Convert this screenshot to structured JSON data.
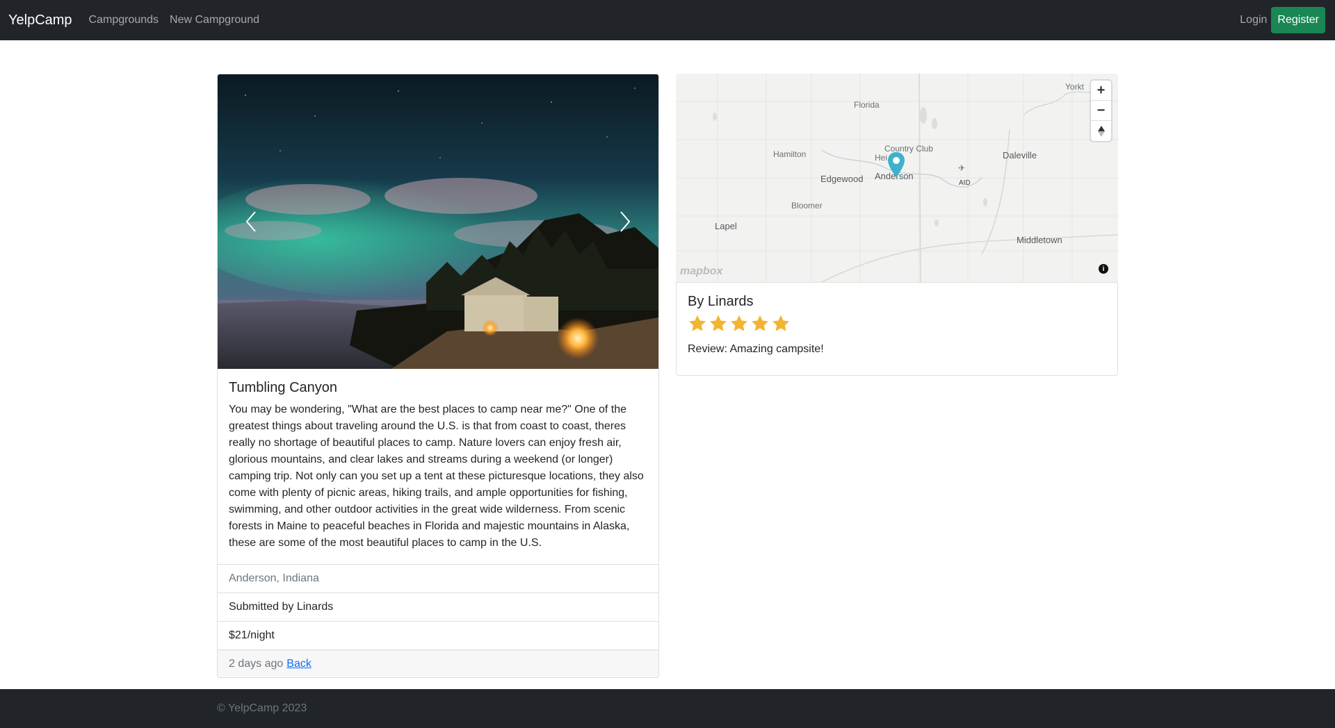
{
  "nav": {
    "brand": "YelpCamp",
    "links": [
      "Campgrounds",
      "New Campground"
    ],
    "login": "Login",
    "register": "Register"
  },
  "campground": {
    "title": "Tumbling Canyon",
    "description": "You may be wondering, \"What are the best places to camp near me?\" One of the greatest things about traveling around the U.S. is that from coast to coast, theres really no shortage of beautiful places to camp. Nature lovers can enjoy fresh air, glorious mountains, and clear lakes and streams during a weekend (or longer) camping trip. Not only can you set up a tent at these picturesque locations, they also come with plenty of picnic areas, hiking trails, and ample opportunities for fishing, swimming, and other outdoor activities in the great wide wilderness. From scenic forests in Maine to peaceful beaches in Florida and majestic mountains in Alaska, these are some of the most beautiful places to camp in the U.S.",
    "location": "Anderson, Indiana",
    "submitted_by": "Submitted by Linards",
    "price": "$21/night",
    "posted": "2 days ago",
    "back_link": "Back"
  },
  "map": {
    "labels": {
      "florida": "Florida",
      "yorktown": "Yorkt",
      "country_club": "Country Club",
      "hei": "Hei",
      "hamilton": "Hamilton",
      "daleville": "Daleville",
      "edgewood": "Edgewood",
      "anderson": "Anderson",
      "aid": "AID",
      "bloomer": "Bloomer",
      "lapel": "Lapel",
      "middletown": "Middletown"
    },
    "zoom_in": "+",
    "zoom_out": "−",
    "attribution_logo": "mapbox",
    "info": "i",
    "marker_color": "#3FB1CE"
  },
  "review": {
    "author": "By Linards",
    "rating": 5,
    "rating_max": 5,
    "text": "Review: Amazing campsite!",
    "star_color": "#F3B431"
  },
  "footer": {
    "copyright": "© YelpCamp 2023"
  }
}
